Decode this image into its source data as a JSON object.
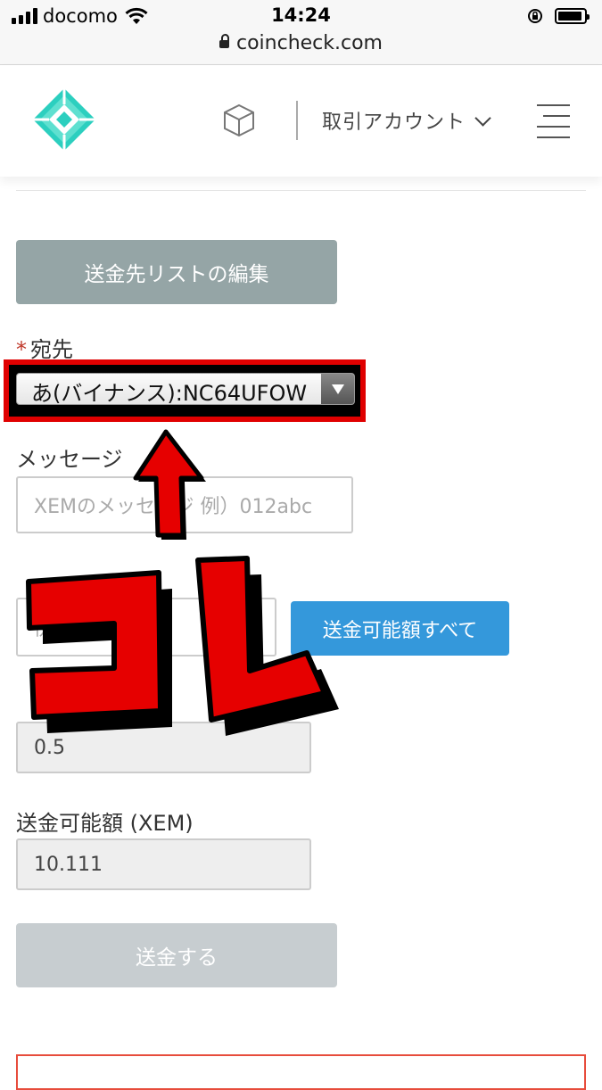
{
  "status_bar": {
    "carrier": "docomo",
    "time": "14:24",
    "url": "coincheck.com",
    "icons": [
      "signal-icon",
      "wifi-icon",
      "lock-icon",
      "rotation-lock-icon",
      "battery-icon"
    ]
  },
  "header": {
    "account_label": "取引アカウント",
    "icons": [
      "coincheck-logo",
      "cube-icon",
      "chevron-down-icon",
      "hamburger-menu-icon"
    ]
  },
  "form": {
    "edit_list_button": "送金先リストの編集",
    "destination": {
      "required_mark": "*",
      "label": "宛先",
      "selected": "あ(バイナンス):NC64UFOW"
    },
    "message": {
      "label": "メッセージ",
      "placeholder": "XEMのメッセージ 例）012abc"
    },
    "amount": {
      "placeholder": "例) 0.01",
      "send_all_button": "送金可能額すべて"
    },
    "fee": {
      "value": "0.5"
    },
    "available": {
      "label": "送金可能額 (XEM)",
      "value": "10.111"
    },
    "submit_button": "送金する"
  },
  "annotation": {
    "callout_text": "コレ",
    "color": "#e60000"
  },
  "colors": {
    "brand_teal": "#2ccfbf",
    "gray_button": "#95a5a6",
    "blue_button": "#3498db",
    "disabled_button": "#c7cdd0",
    "required": "#c0392b"
  }
}
